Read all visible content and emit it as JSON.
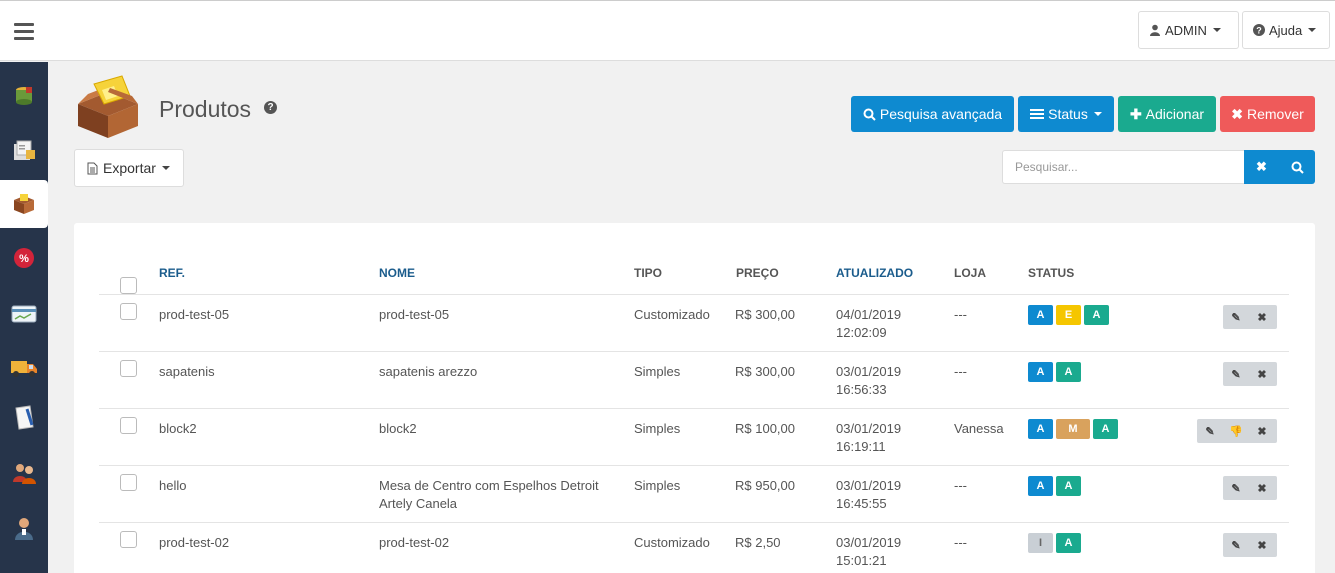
{
  "topbar": {
    "user_label": "ADMIN",
    "help_label": "Ajuda"
  },
  "sidebar": {
    "items": [
      {
        "icon": "database-icon"
      },
      {
        "icon": "catalog-icon"
      },
      {
        "icon": "product-box-icon",
        "active": true
      },
      {
        "icon": "discount-icon"
      },
      {
        "icon": "payment-card-icon"
      },
      {
        "icon": "delivery-truck-icon"
      },
      {
        "icon": "document-icon"
      },
      {
        "icon": "customers-icon"
      },
      {
        "icon": "user-icon"
      }
    ]
  },
  "page": {
    "title": "Produtos",
    "help": "?"
  },
  "actions": {
    "advanced_search": "Pesquisa avançada",
    "status": "Status",
    "add": "Adicionar",
    "remove": "Remover",
    "export": "Exportar"
  },
  "search": {
    "placeholder": "Pesquisar...",
    "value": ""
  },
  "table": {
    "columns": [
      "REF.",
      "NOME",
      "TIPO",
      "PREÇO",
      "ATUALIZADO",
      "LOJA",
      "STATUS"
    ],
    "rows": [
      {
        "ref": "prod-test-05",
        "nome": [
          "prod-test-05",
          ""
        ],
        "tipo": "Customizado",
        "preco": "R$ 300,00",
        "data": "04/01/2019",
        "hora": "12:02:09",
        "loja": "---",
        "status": [
          {
            "t": "A",
            "c": "blue"
          },
          {
            "t": "E",
            "c": "yellow"
          },
          {
            "t": "A",
            "c": "teal"
          }
        ],
        "actions": [
          "edit",
          "delete"
        ]
      },
      {
        "ref": "sapatenis",
        "nome": [
          "sapatenis arezzo",
          ""
        ],
        "tipo": "Simples",
        "preco": "R$ 300,00",
        "data": "03/01/2019",
        "hora": "16:56:33",
        "loja": "---",
        "status": [
          {
            "t": "A",
            "c": "blue"
          },
          {
            "t": "A",
            "c": "teal"
          }
        ],
        "actions": [
          "edit",
          "delete"
        ]
      },
      {
        "ref": "block2",
        "nome": [
          "block2",
          ""
        ],
        "tipo": "Simples",
        "preco": "R$ 100,00",
        "data": "03/01/2019",
        "hora": "16:19:11",
        "loja": "Vanessa",
        "status": [
          {
            "t": "A",
            "c": "blue"
          },
          {
            "t": "M",
            "c": "orange"
          },
          {
            "t": "A",
            "c": "teal"
          }
        ],
        "actions": [
          "edit",
          "dislike",
          "delete"
        ]
      },
      {
        "ref": "hello",
        "nome": [
          "Mesa de Centro com Espelhos Detroit",
          "Artely Canela"
        ],
        "tipo": "Simples",
        "preco": "R$ 950,00",
        "data": "03/01/2019",
        "hora": "16:45:55",
        "loja": "---",
        "status": [
          {
            "t": "A",
            "c": "blue"
          },
          {
            "t": "A",
            "c": "teal"
          }
        ],
        "actions": [
          "edit",
          "delete"
        ]
      },
      {
        "ref": "prod-test-02",
        "nome": [
          "prod-test-02",
          ""
        ],
        "tipo": "Customizado",
        "preco": "R$ 2,50",
        "data": "03/01/2019",
        "hora": "15:01:21",
        "loja": "---",
        "status": [
          {
            "t": "I",
            "c": "grey"
          },
          {
            "t": "A",
            "c": "teal"
          }
        ],
        "actions": [
          "edit",
          "delete"
        ]
      }
    ]
  },
  "colors": {
    "primary": "#0e8ad0",
    "success": "#1aaa8f",
    "danger": "#ef5a5a",
    "sidebar": "#26344a"
  }
}
